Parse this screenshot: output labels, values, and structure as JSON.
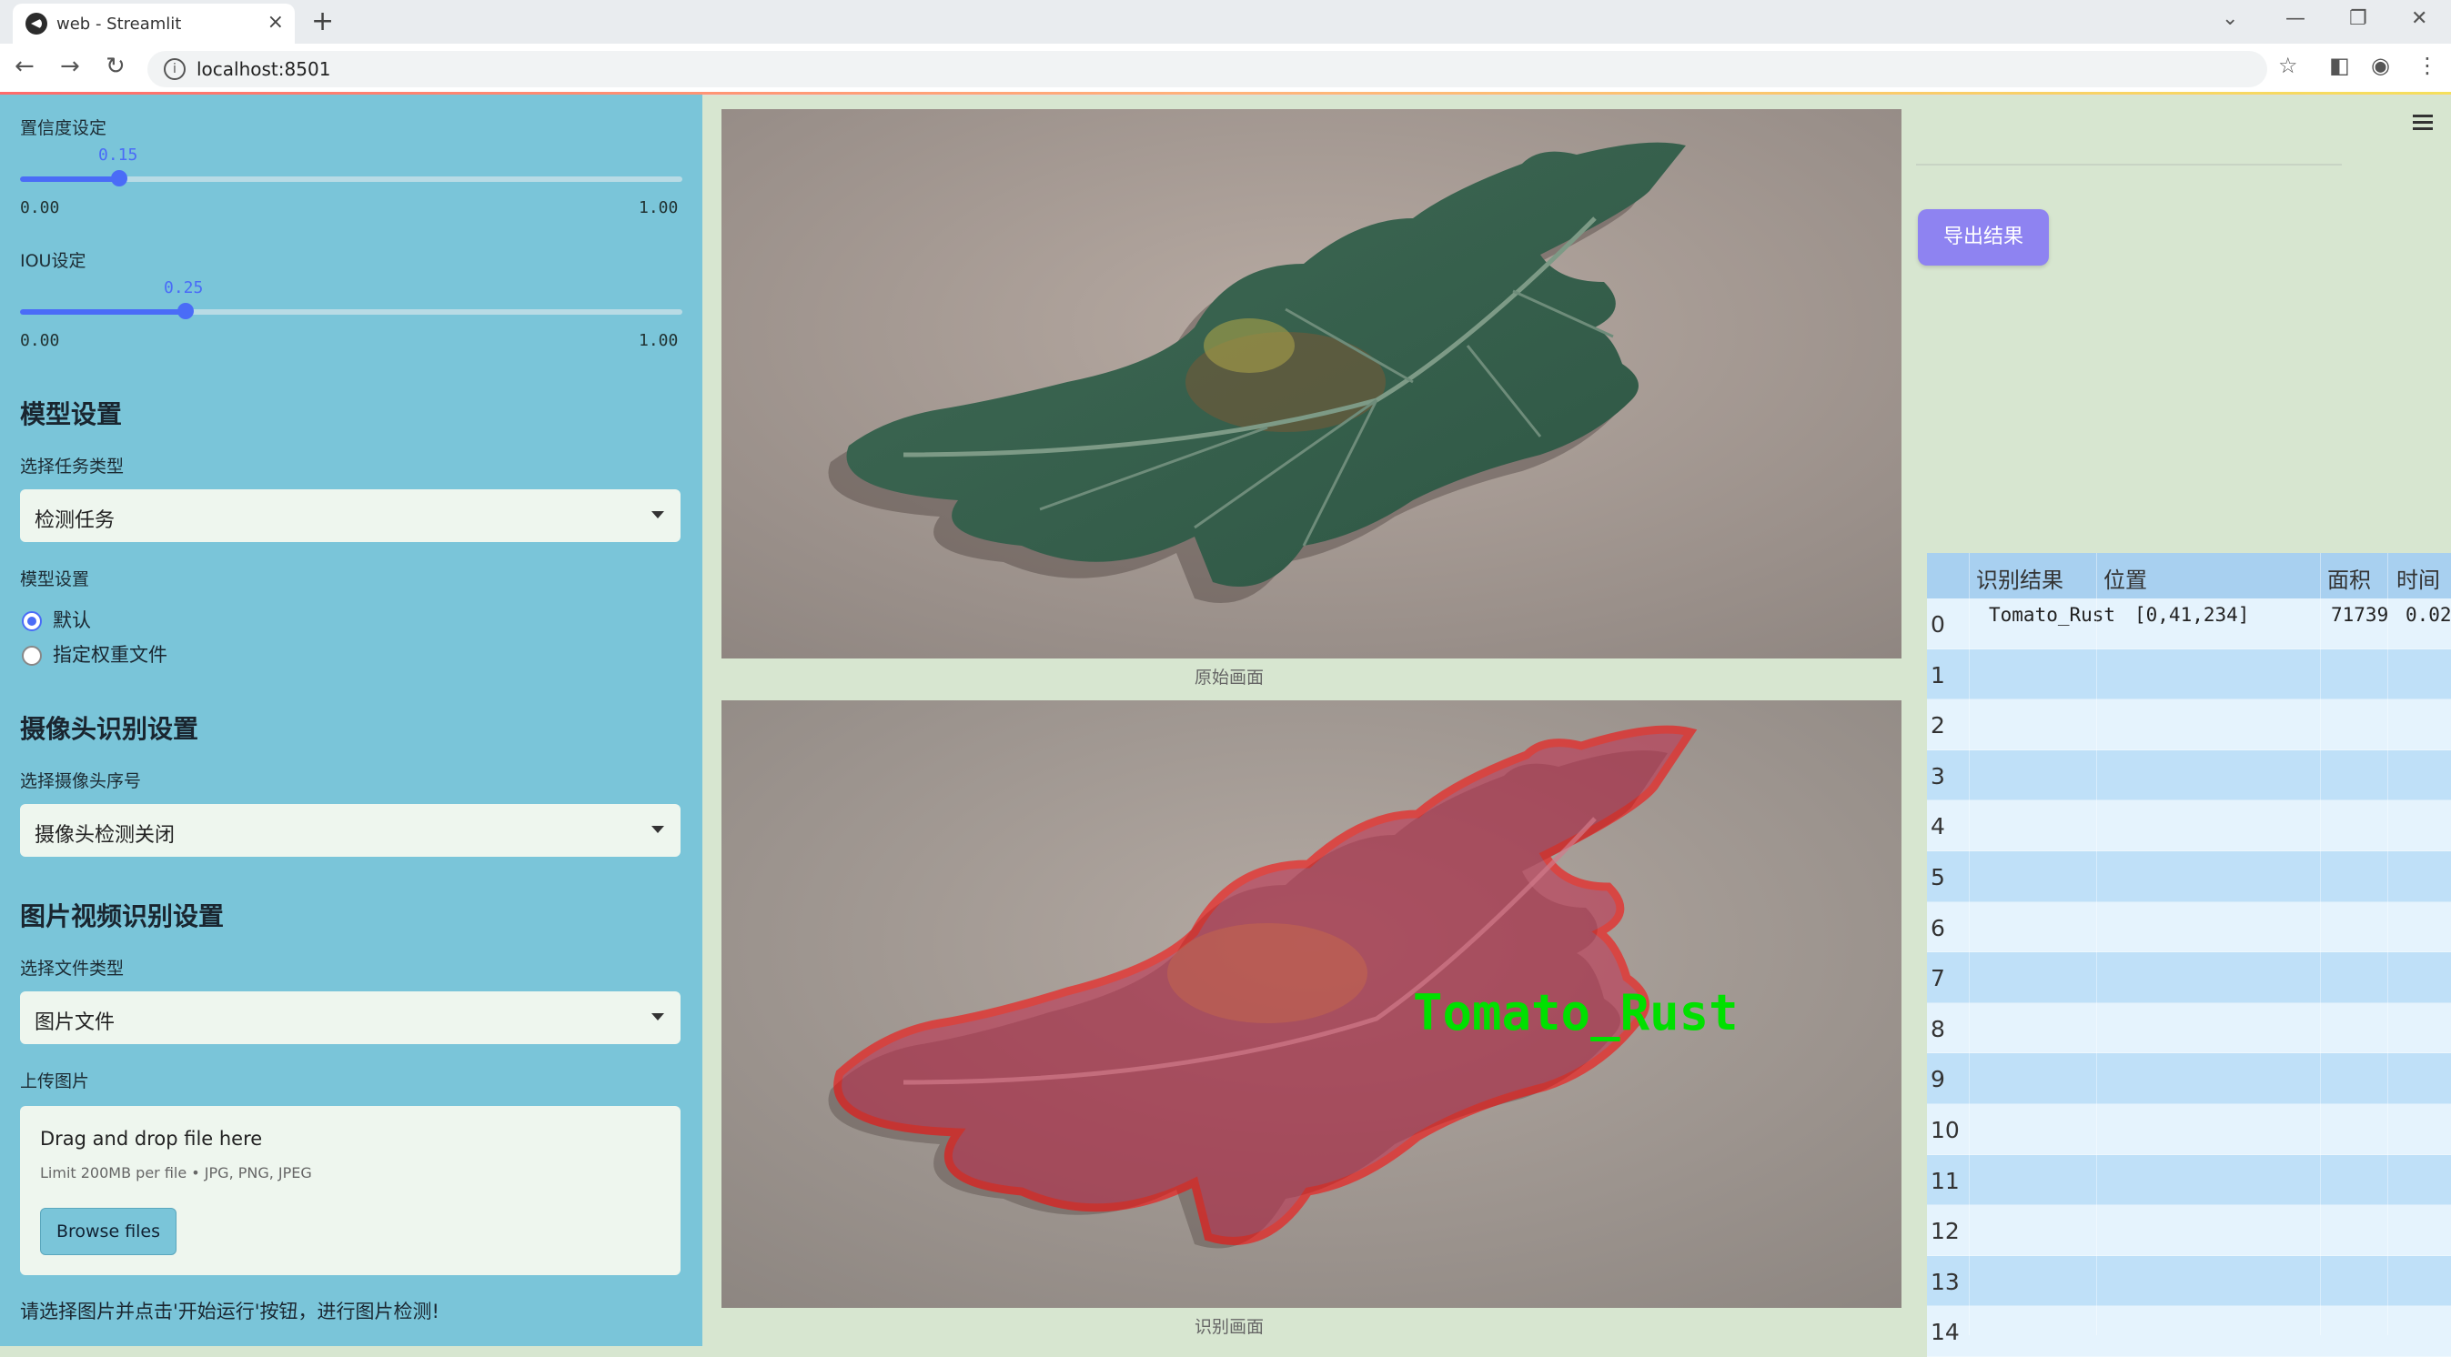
{
  "browser": {
    "tab_title": "web - Streamlit",
    "url": "localhost:8501"
  },
  "sidebar": {
    "confidence": {
      "label": "置信度设定",
      "value": "0.15",
      "value_num": 0.15,
      "min": "0.00",
      "max": "1.00"
    },
    "iou": {
      "label": "IOU设定",
      "value": "0.25",
      "value_num": 0.25,
      "min": "0.00",
      "max": "1.00"
    },
    "model_section": {
      "title": "模型设置",
      "task_label": "选择任务类型",
      "task_value": "检测任务",
      "model_label": "模型设置",
      "options": [
        "默认",
        "指定权重文件"
      ],
      "selected": "默认"
    },
    "camera_section": {
      "title": "摄像头识别设置",
      "camera_label": "选择摄像头序号",
      "camera_value": "摄像头检测关闭"
    },
    "media_section": {
      "title": "图片视频识别设置",
      "file_type_label": "选择文件类型",
      "file_type_value": "图片文件",
      "upload_label": "上传图片",
      "drop_title": "Drag and drop file here",
      "drop_limit": "Limit 200MB per file • JPG, PNG, JPEG",
      "browse_label": "Browse files"
    },
    "hint": "请选择图片并点击'开始运行'按钮，进行图片检测!"
  },
  "main": {
    "original_caption": "原始画面",
    "result_caption": "识别画面",
    "detection_label": "Tomato_Rust",
    "export_label": "导出结果"
  },
  "table": {
    "headers": [
      "识别结果",
      "位置",
      "面积",
      "时间"
    ],
    "rows": [
      {
        "index": "0",
        "result": "Tomato_Rust",
        "position": "[0,41,234]",
        "area": "71739",
        "time": "0.02"
      },
      {
        "index": "1"
      },
      {
        "index": "2"
      },
      {
        "index": "3"
      },
      {
        "index": "4"
      },
      {
        "index": "5"
      },
      {
        "index": "6"
      },
      {
        "index": "7"
      },
      {
        "index": "8"
      },
      {
        "index": "9"
      },
      {
        "index": "10"
      },
      {
        "index": "11"
      },
      {
        "index": "12"
      },
      {
        "index": "13"
      },
      {
        "index": "14"
      }
    ]
  },
  "colors": {
    "sidebar_bg": "#7ac5d9",
    "accent": "#4a6cf7",
    "export_button": "#8e83f1",
    "detection_outline": "#ff0000",
    "detection_text": "#00e000"
  }
}
